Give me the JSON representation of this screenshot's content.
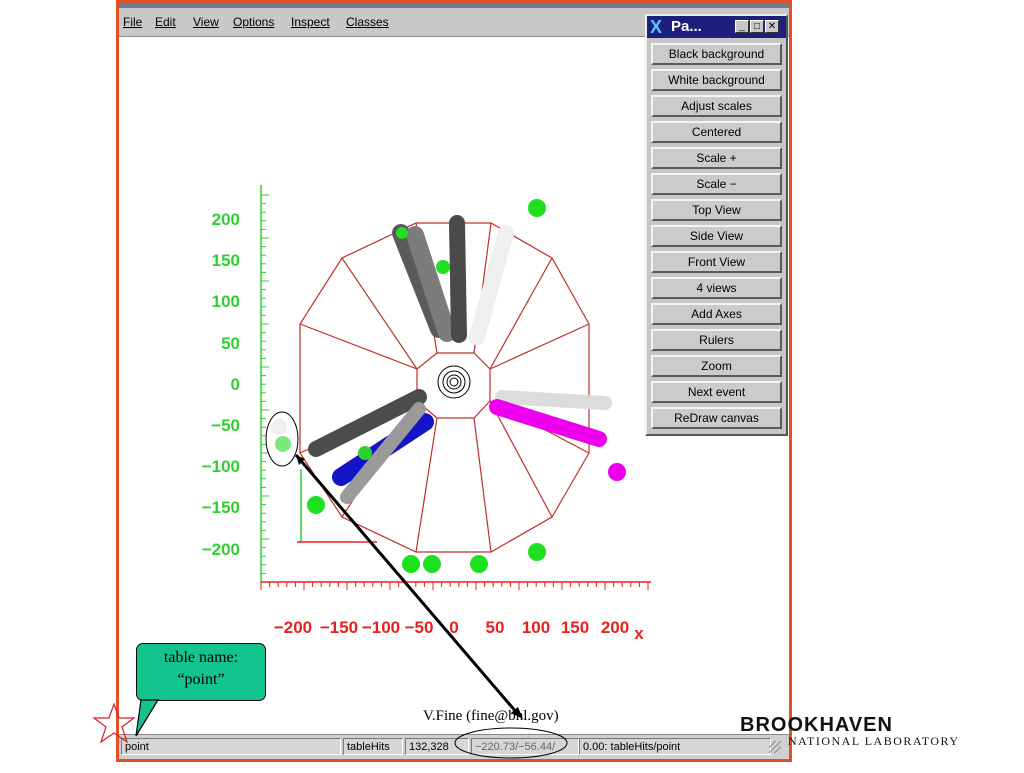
{
  "menubar": [
    "File",
    "Edit",
    "View",
    "Options",
    "Inspect",
    "Classes"
  ],
  "panel": {
    "title": "Pa...",
    "buttons": [
      "Black background",
      "White background",
      "Adjust scales",
      "Centered",
      "Scale +",
      "Scale −",
      "Top View",
      "Side View",
      "Front View",
      "4 views",
      "Add Axes",
      "Rulers",
      "Zoom",
      "Next event",
      "ReDraw canvas"
    ]
  },
  "axes": {
    "y_ticks": [
      "200",
      "150",
      "100",
      "50",
      "0",
      "−50",
      "−100",
      "−150",
      "−200"
    ],
    "x_ticks": [
      "−200",
      "−150",
      "−100",
      "−50",
      "0",
      "50",
      "100",
      "150",
      "200"
    ],
    "x_label": "x"
  },
  "status": {
    "object": "point",
    "class": "tableHits",
    "coords": "132,328",
    "position": "−220.73/−56.44/",
    "info": "0.00: tableHits/point"
  },
  "callout": {
    "line1": "table name:",
    "line2": "“point”"
  },
  "author": "V.Fine (fine@bnl.gov)",
  "logo": {
    "brand": "BROOKHAVEN",
    "lab": "NATIONAL LABORATORY"
  },
  "colors": {
    "window_border": "#e2502a",
    "axis_green": "#2ed12e",
    "axis_red": "#e8201e",
    "callout": "#14c48f"
  }
}
